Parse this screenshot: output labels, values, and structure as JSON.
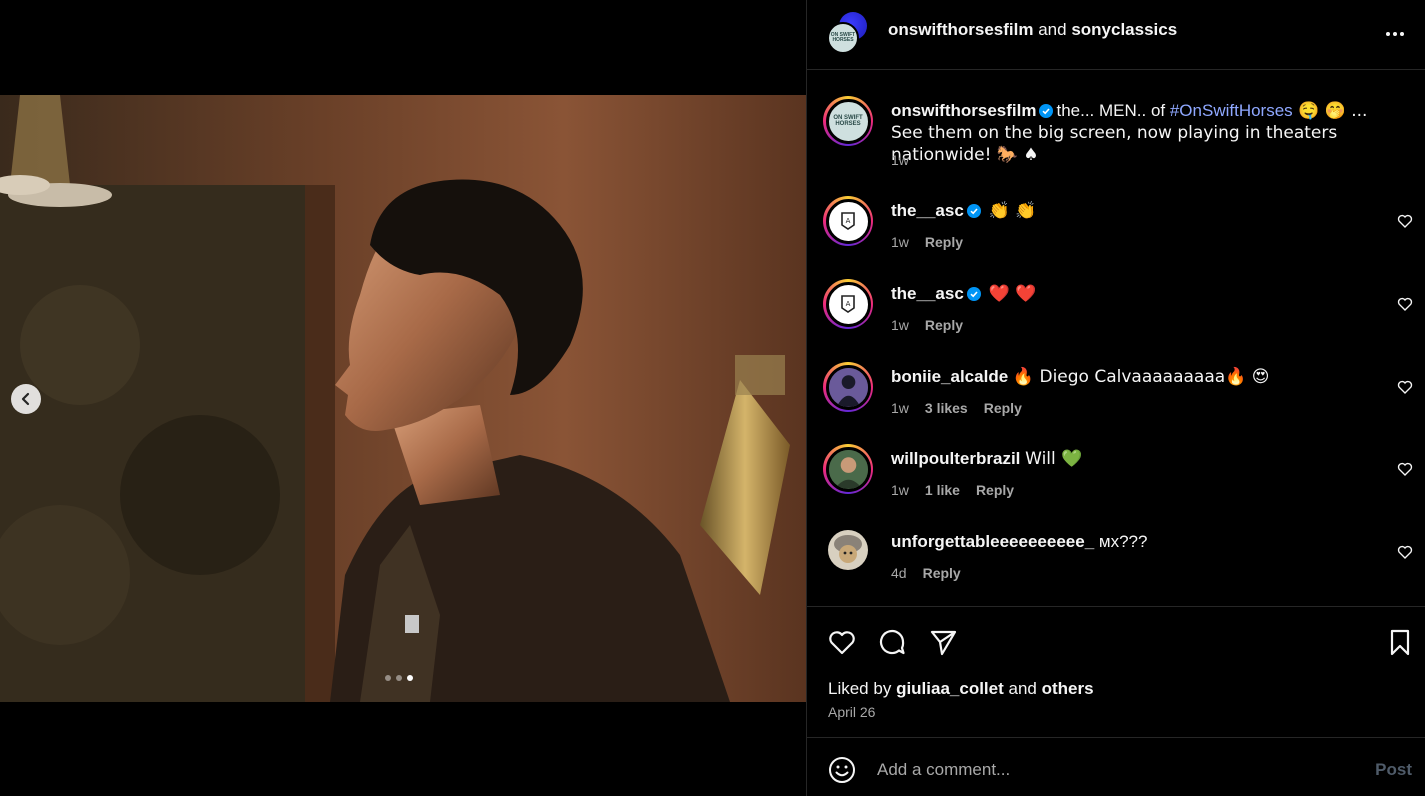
{
  "post": {
    "header": {
      "author": "onswifthorsesfilm",
      "joiner": "and",
      "collaborator": "sonyclassics",
      "avatar_logo_text": "ON SWIFT HORSES"
    },
    "carousel": {
      "slide_count": 3,
      "active_slide": 3
    },
    "caption": {
      "user": "onswifthorsesfilm",
      "text_before": "the... MEN.. of ",
      "hashtag": "#OnSwiftHorses",
      "text_after": " 🤤 🤭 ... See them on the big screen, now playing in theaters nationwide! 🐎 ♠",
      "time": "1w",
      "avatar_logo_text": "ON SWIFT HORSES"
    },
    "comments": [
      {
        "user": "the__asc",
        "verified": true,
        "text": "👏 👏",
        "time": "1w",
        "likes": "",
        "reply": "Reply"
      },
      {
        "user": "the__asc",
        "verified": true,
        "text": "❤️ ❤️",
        "time": "1w",
        "likes": "",
        "reply": "Reply"
      },
      {
        "user": "boniie_alcalde",
        "verified": false,
        "text": "🔥 Diego Calvaaaaaaaaa🔥 😍",
        "time": "1w",
        "likes": "3 likes",
        "reply": "Reply"
      },
      {
        "user": "willpoulterbrazil",
        "verified": false,
        "text": "Will 💚",
        "time": "1w",
        "likes": "1 like",
        "reply": "Reply"
      },
      {
        "user": "unforgettableeeeeeeeee_",
        "verified": false,
        "text": "ᴍx???",
        "time": "4d",
        "likes": "",
        "reply": "Reply"
      }
    ],
    "likes": {
      "prefix": "Liked by",
      "user": "giuliaa_collet",
      "joiner": "and",
      "others": "others"
    },
    "date": "April 26",
    "add_comment": {
      "placeholder": "Add a comment...",
      "post_label": "Post"
    }
  },
  "colors": {
    "background": "#000000",
    "text": "#f5f5f5",
    "secondary_text": "#a8a8a8",
    "divider": "#262626",
    "hashtag": "#8fa8ff",
    "verified": "#0095f6",
    "post_button_disabled": "#4f5b69"
  },
  "icons": {
    "prev": "chevron-left-icon",
    "more": "more-horizontal-icon",
    "like": "heart-icon",
    "comment": "comment-icon",
    "share": "send-icon",
    "save": "bookmark-icon",
    "emoji": "smile-icon",
    "verified": "verified-badge-icon"
  }
}
